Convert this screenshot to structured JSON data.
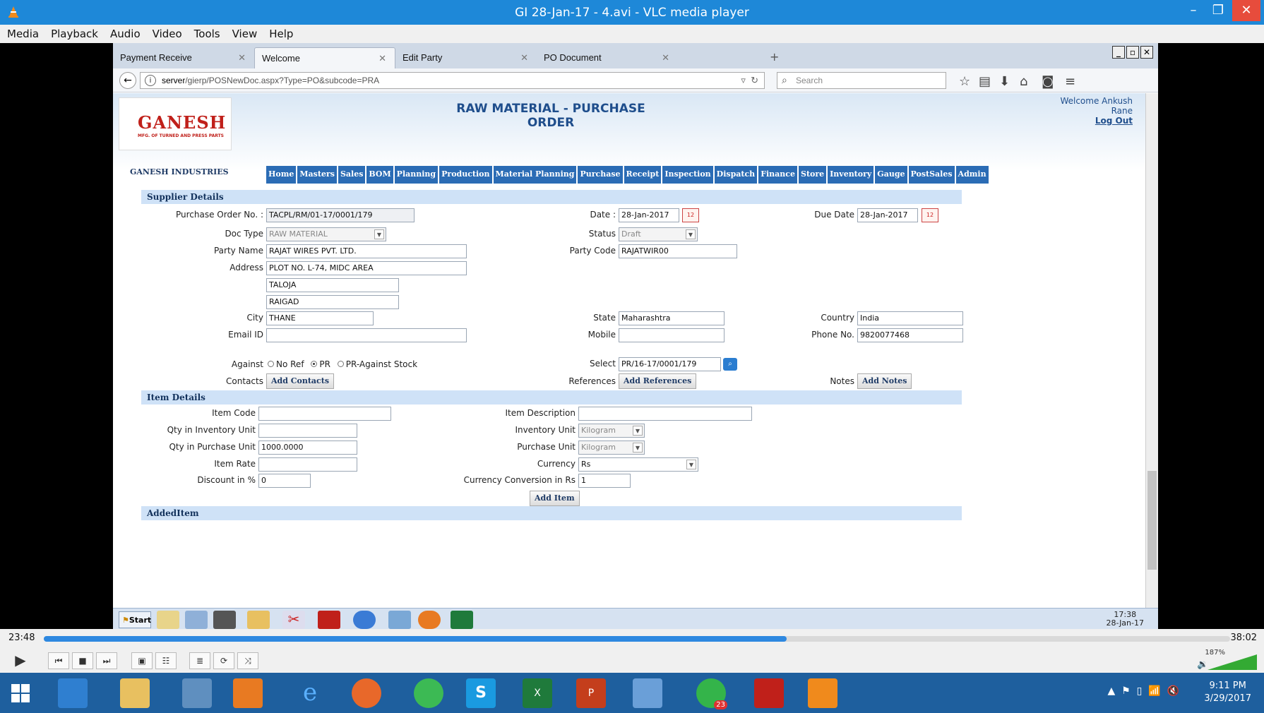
{
  "vlc": {
    "title": "GI 28-Jan-17 - 4.avi - VLC media player",
    "menu": [
      "Media",
      "Playback",
      "Audio",
      "Video",
      "Tools",
      "View",
      "Help"
    ],
    "elapsed": "23:48",
    "total": "38:02",
    "progress": 0.626,
    "volume_pct": "187%"
  },
  "browser": {
    "tabs": [
      "Payment Receive",
      "Welcome",
      "Edit Party",
      "PO Document"
    ],
    "url_host": "server",
    "url_path": "/gierp/POSNewDoc.aspx?Type=PO&subcode=PRA",
    "search_placeholder": "Search"
  },
  "header": {
    "logo_text": "GANESH",
    "logo_sub": "MFG. OF TURNED AND PRESS PARTS",
    "title": "RAW MATERIAL - PURCHASE ORDER",
    "welcome": "Welcome Ankush",
    "welcome_name": "Rane",
    "logout": "Log Out",
    "company": "GANESH INDUSTRIES"
  },
  "menu": [
    "Home",
    "Masters",
    "Sales",
    "BOM",
    "Planning",
    "Production",
    "Material Planning",
    "Purchase",
    "Receipt",
    "Inspection",
    "Dispatch",
    "Finance",
    "Store",
    "Inventory",
    "Gauge",
    "PostSales",
    "Admin"
  ],
  "supplier": {
    "section": "Supplier Details",
    "po_label": "Purchase Order No. :",
    "po_value": "TACPL/RM/01-17/0001/179",
    "date_label": "Date :",
    "date_value": "28-Jan-2017",
    "due_label": "Due Date",
    "due_value": "28-Jan-2017",
    "doctype_label": "Doc Type",
    "doctype_value": "RAW MATERIAL",
    "status_label": "Status",
    "status_value": "Draft",
    "party_label": "Party Name",
    "party_value": "RAJAT WIRES PVT. LTD.",
    "partycode_label": "Party Code",
    "partycode_value": "RAJATWIR00",
    "address_label": "Address",
    "address1": "PLOT NO. L-74, MIDC AREA",
    "address2": "TALOJA",
    "address3": "RAIGAD",
    "city_label": "City",
    "city_value": "THANE",
    "state_label": "State",
    "state_value": "Maharashtra",
    "country_label": "Country",
    "country_value": "India",
    "email_label": "Email ID",
    "email_value": "",
    "mobile_label": "Mobile",
    "mobile_value": "",
    "phone_label": "Phone No.",
    "phone_value": "9820077468",
    "against_label": "Against",
    "against_options": [
      "No Ref",
      "PR",
      "PR-Against Stock"
    ],
    "against_selected": "PR",
    "select_label": "Select",
    "select_value": "PR/16-17/0001/179",
    "contacts_label": "Contacts",
    "contacts_btn": "Add Contacts",
    "refs_label": "References",
    "refs_btn": "Add References",
    "notes_label": "Notes",
    "notes_btn": "Add Notes"
  },
  "item": {
    "section": "Item Details",
    "code_label": "Item Code",
    "code_value": "",
    "desc_label": "Item Description",
    "desc_value": "",
    "qty_inv_label": "Qty in Inventory Unit",
    "qty_inv_value": "",
    "inv_unit_label": "Inventory Unit",
    "inv_unit_value": "Kilogram",
    "qty_pur_label": "Qty in Purchase Unit",
    "qty_pur_value": "1000.0000",
    "pur_unit_label": "Purchase Unit",
    "pur_unit_value": "Kilogram",
    "rate_label": "Item Rate",
    "rate_value": "",
    "currency_label": "Currency",
    "currency_value": "Rs",
    "discount_label": "Discount in %",
    "discount_value": "0",
    "conv_label": "Currency Conversion in Rs",
    "conv_value": "1",
    "add_btn": "Add Item"
  },
  "added": {
    "section": "AddedItem"
  },
  "remote_taskbar": {
    "start": "Start",
    "time": "17:38",
    "date": "28-Jan-17"
  },
  "windows": {
    "time": "9:11 PM",
    "date": "3/29/2017",
    "whatsapp_badge": "23"
  },
  "colors": {
    "vlc_blue": "#1e88d8",
    "menu_blue": "#2b6cb5",
    "section_bg": "#cfe2f7"
  }
}
